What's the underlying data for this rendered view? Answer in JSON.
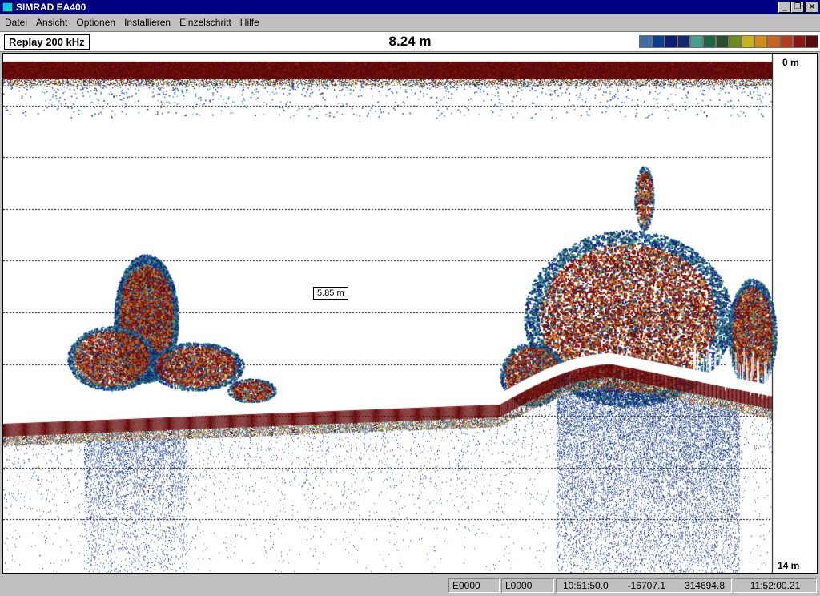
{
  "window": {
    "title": "SIMRAD EA400"
  },
  "menu": {
    "items": [
      {
        "label": "Datei"
      },
      {
        "label": "Ansicht"
      },
      {
        "label": "Optionen"
      },
      {
        "label": "Installieren"
      },
      {
        "label": "Einzelschritt"
      },
      {
        "label": "Hilfe"
      }
    ]
  },
  "info_bar": {
    "mode_label": "Replay 200 kHz",
    "depth_readout": "8.24 m",
    "color_scale": [
      "#3a6ea5",
      "#0a3c8c",
      "#0a1e78",
      "#14286e",
      "#46a08c",
      "#1e6446",
      "#28502d",
      "#6e8c1e",
      "#c8b414",
      "#d28c14",
      "#c8641e",
      "#b43c1e",
      "#8c1414",
      "#5a0a0a"
    ]
  },
  "echogram": {
    "scale_top": "0 m",
    "scale_bottom": "14 m",
    "marker_depth": "5.85 m"
  },
  "status_bar": {
    "cell_e": "E0000",
    "cell_l": "L0000",
    "time_ping": "10:51:50.0",
    "coord_x": "-16707.1",
    "coord_y": "314694.8",
    "time_clock": "11:52:00.21"
  }
}
